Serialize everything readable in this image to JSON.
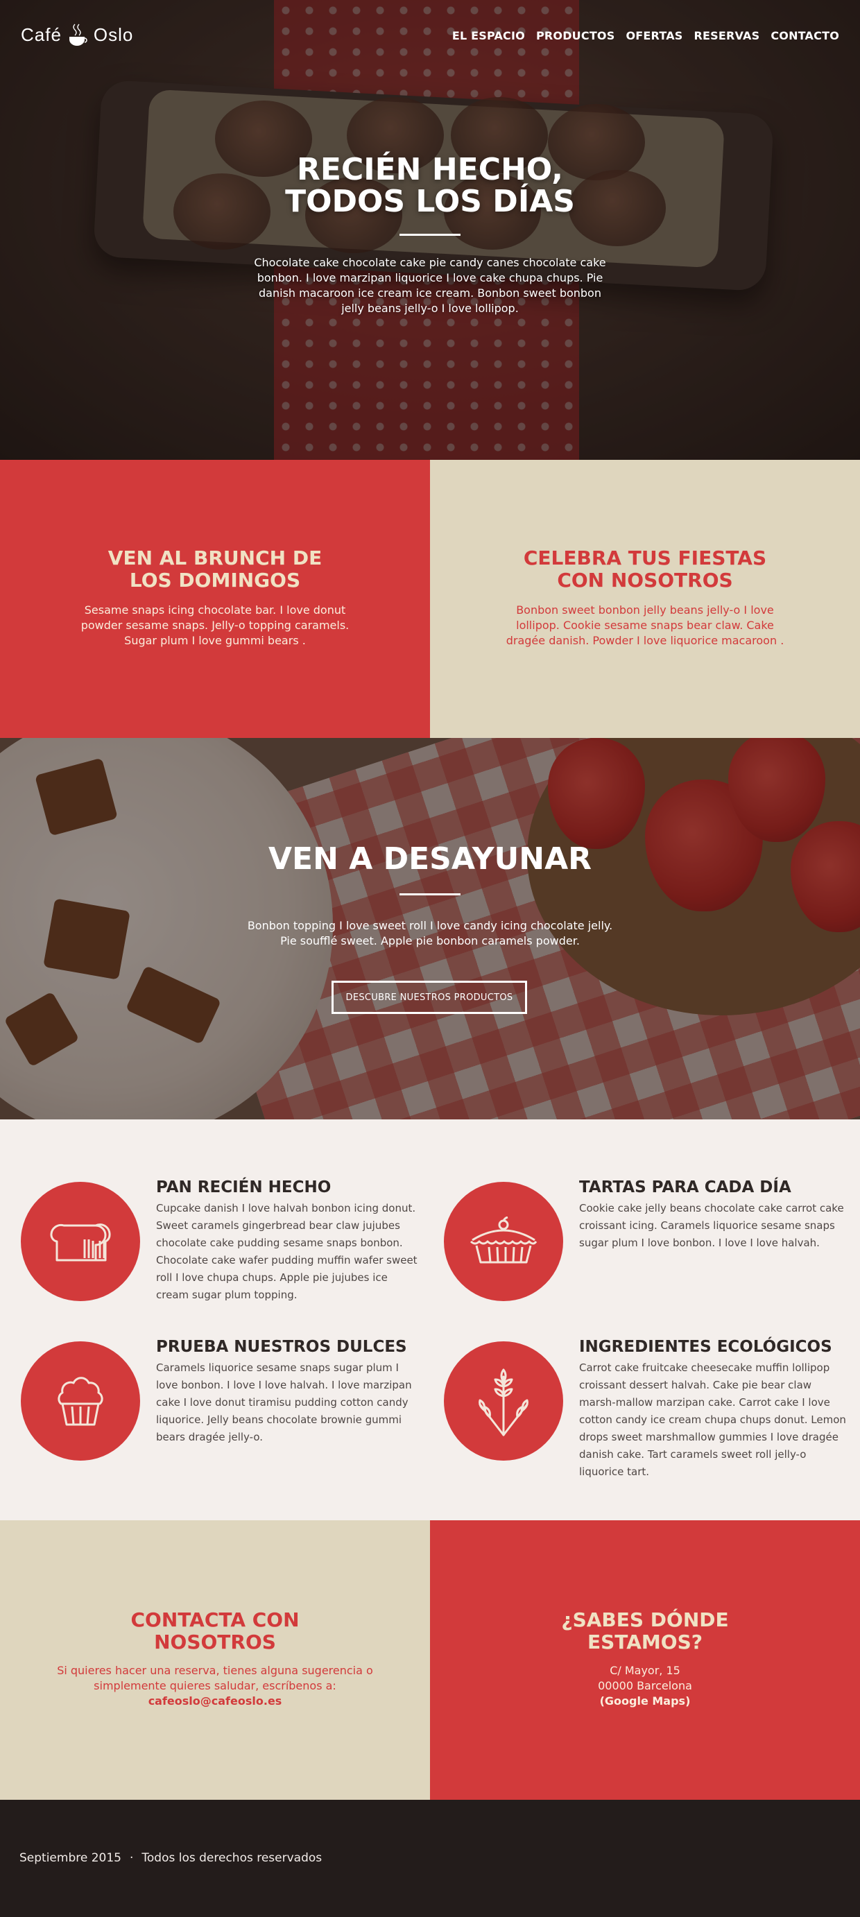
{
  "brand": {
    "name_left": "Café",
    "name_right": "Oslo"
  },
  "nav": {
    "items": [
      "EL ESPACIO",
      "PRODUCTOS",
      "OFERTAS",
      "RESERVAS",
      "CONTACTO"
    ]
  },
  "hero": {
    "title": "RECIÉN HECHO,\nTODOS LOS DÍAS",
    "text": "Chocolate cake chocolate cake pie candy canes chocolate cake bonbon. I love marzipan liquorice I love cake chupa chups. Pie danish macaroon ice cream ice cream. Bonbon sweet bonbon jelly beans jelly-o I love lollipop."
  },
  "panels": {
    "brunch": {
      "title": "VEN AL BRUNCH DE\nLOS DOMINGOS",
      "text": "Sesame snaps icing chocolate bar. I love donut powder sesame snaps. Jelly-o topping caramels. Sugar plum I love gummi bears ."
    },
    "fiestas": {
      "title": "CELEBRA TUS FIESTAS\nCON NOSOTROS",
      "text": "Bonbon sweet bonbon jelly beans jelly-o I love lollipop. Cookie sesame snaps bear claw. Cake dragée danish. Powder I love liquorice macaroon ."
    }
  },
  "breakfast": {
    "title": "VEN A DESAYUNAR",
    "text": "Bonbon topping I love sweet roll I love candy icing chocolate jelly. Pie soufflé sweet. Apple pie bonbon caramels powder.",
    "button": "DESCUBRE NUESTROS PRODUCTOS"
  },
  "features": [
    {
      "icon": "bread-icon",
      "title": "PAN RECIÉN HECHO",
      "text": "Cupcake danish I love halvah bonbon icing donut. Sweet caramels gingerbread bear claw jujubes chocolate cake pudding sesame snaps bonbon. Chocolate cake wafer pudding muffin wafer sweet roll I love chupa chups. Apple pie jujubes ice cream sugar plum topping."
    },
    {
      "icon": "pie-icon",
      "title": "TARTAS PARA CADA DÍA",
      "text": "Cookie cake jelly beans chocolate cake carrot cake croissant icing. Caramels liquorice sesame snaps sugar plum I love bonbon. I love I love halvah."
    },
    {
      "icon": "cupcake-icon",
      "title": "PRUEBA NUESTROS DULCES",
      "text": "Caramels liquorice sesame snaps sugar plum I love bonbon. I love I love halvah. I love marzipan cake I love donut tiramisu pudding cotton candy liquorice. Jelly beans chocolate brownie gummi bears dragée jelly-o."
    },
    {
      "icon": "wheat-icon",
      "title": "INGREDIENTES ECOLÓGICOS",
      "text": "Carrot cake fruitcake cheesecake muffin lollipop croissant dessert halvah. Cake pie bear claw marsh-mallow marzipan cake. Carrot cake I love cotton candy ice cream chupa chups donut. Lemon drops sweet marshmallow gummies I love dragée danish cake. Tart caramels sweet roll jelly-o liquorice tart."
    }
  ],
  "contact": {
    "title": "CONTACTA CON\nNOSOTROS",
    "text": "Si quieres hacer una reserva, tienes alguna sugerencia o simplemente quieres saludar, escríbenos a:",
    "email": "cafeoslo@cafeoslo.es"
  },
  "location": {
    "title": "¿SABES DÓNDE\nESTAMOS?",
    "address1": "C/ Mayor, 15",
    "address2": "00000 Barcelona",
    "map_link": "(Google Maps)"
  },
  "footer": {
    "date": "Septiembre 2015",
    "separator": "·",
    "rights": "Todos los derechos reservados"
  },
  "colors": {
    "red": "#d23a3b",
    "beige": "#dfd6be",
    "dark": "#231c1b",
    "light": "#f4efec"
  }
}
